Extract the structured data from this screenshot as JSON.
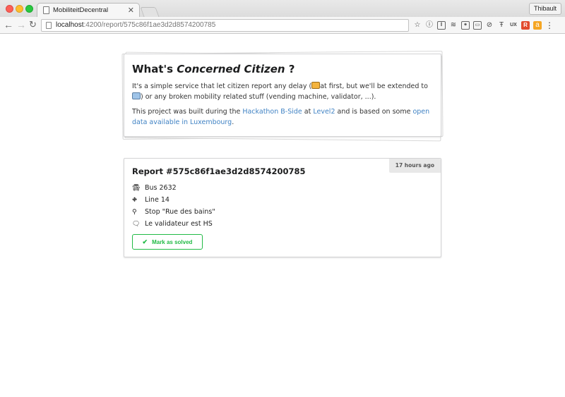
{
  "browser": {
    "tab_title": "MobiliteitDecentral",
    "tab_close": "✕",
    "profile_name": "Thibault",
    "url_host": "localhost",
    "url_path": ":4200/report/575c86f1ae3d2d8574200785",
    "extensions": [
      "star-icon",
      "info-icon",
      "ext-icon",
      "layers-icon",
      "ext-icon",
      "cast-icon",
      "ban-icon",
      "t-icon",
      "ux-icon",
      "r-icon",
      "amazon-icon",
      "menu-icon"
    ]
  },
  "intro": {
    "title_prefix": "What's ",
    "title_em": "Concerned Citizen",
    "title_suffix": " ?",
    "p1_a": "It's a simple service that let citizen report any delay (",
    "p1_b": "at first, but we'll be extended to ",
    "p1_c": ") or any broken mobility related stuff (vending machine, validator, ...).",
    "p2_a": "This project was built during the ",
    "p2_link1": "Hackathon B-Side",
    "p2_b": " at ",
    "p2_link2": "Level2",
    "p2_c": " and is based on some ",
    "p2_link3": "open data available in Luxembourg",
    "p2_d": "."
  },
  "report": {
    "title": "Report #575c86f1ae3d2d8574200785",
    "time": "17 hours ago",
    "bus": "Bus 2632",
    "line": "Line 14",
    "stop": "Stop \"Rue des bains\"",
    "comment": "Le validateur est HS",
    "solve_label": "Mark as solved"
  },
  "colors": {
    "link": "#4183c4",
    "success": "#21ba45"
  }
}
